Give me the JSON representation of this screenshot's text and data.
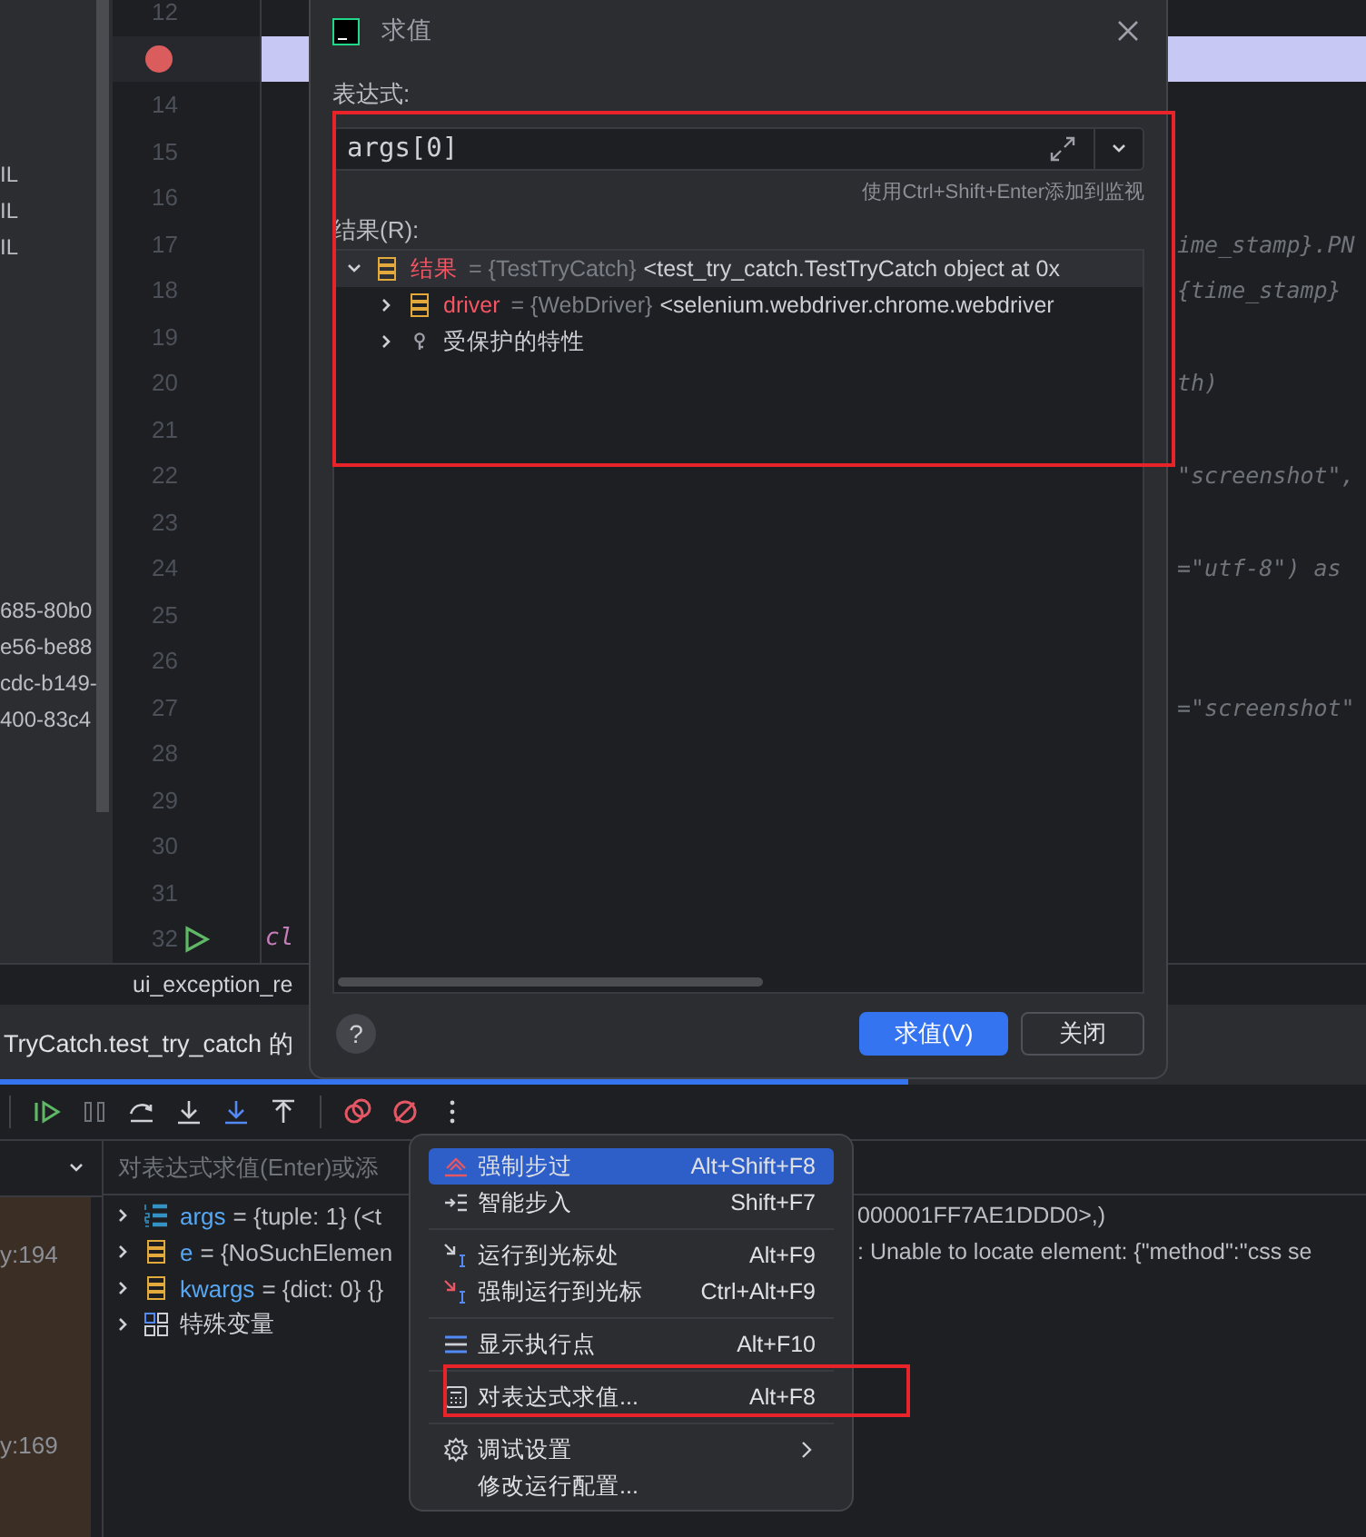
{
  "project_panel": {
    "file_rows": [
      {
        "label": "IL"
      },
      {
        "label": "IL"
      },
      {
        "label": "IL"
      }
    ],
    "id_rows": [
      {
        "label": "685-80b0"
      },
      {
        "label": "e56-be88"
      },
      {
        "label": "cdc-b149-"
      },
      {
        "label": "400-83c4"
      }
    ]
  },
  "editor": {
    "lines": [
      {
        "number": "12",
        "kind": "plain",
        "breakpoint": false,
        "current": false
      },
      {
        "kind": "plain",
        "breakpoint": true,
        "current": true
      },
      {
        "number": "14",
        "kind": "plain",
        "breakpoint": false,
        "current": false
      },
      {
        "number": "15",
        "kind": "plain",
        "breakpoint": false,
        "current": false
      },
      {
        "number": "16",
        "kind": "plain",
        "breakpoint": false,
        "current": false
      },
      {
        "number": "17",
        "kind": "clipped",
        "code": "ime_stamp}.PN",
        "breakpoint": false,
        "current": false
      },
      {
        "number": "18",
        "kind": "clipped",
        "code": "{time_stamp}",
        "breakpoint": false,
        "current": false
      },
      {
        "number": "19",
        "kind": "plain",
        "breakpoint": false,
        "current": false
      },
      {
        "number": "20",
        "kind": "clipped",
        "code": "th)",
        "breakpoint": false,
        "current": false
      },
      {
        "number": "21",
        "kind": "plain",
        "breakpoint": false,
        "current": false
      },
      {
        "number": "22",
        "kind": "clipped",
        "code": "\"screenshot\",",
        "breakpoint": false,
        "current": false
      },
      {
        "number": "23",
        "kind": "plain",
        "breakpoint": false,
        "current": false
      },
      {
        "number": "24",
        "kind": "clipped",
        "code": "=\"utf-8\") as",
        "breakpoint": false,
        "current": false
      },
      {
        "number": "25",
        "kind": "plain",
        "breakpoint": false,
        "current": false
      },
      {
        "number": "26",
        "kind": "plain",
        "breakpoint": false,
        "current": false
      },
      {
        "number": "27",
        "kind": "clipped",
        "code": "=\"screenshot\"",
        "breakpoint": false,
        "current": false
      },
      {
        "number": "28",
        "kind": "plain",
        "breakpoint": false,
        "current": false
      },
      {
        "number": "29",
        "kind": "plain",
        "breakpoint": false,
        "current": false
      },
      {
        "number": "30",
        "kind": "plain",
        "breakpoint": false,
        "current": false
      },
      {
        "number": "31",
        "kind": "plain",
        "breakpoint": false,
        "current": false
      },
      {
        "number": "32",
        "kind": "class",
        "code": "cl",
        "breakpoint": false,
        "current": false
      }
    ]
  },
  "editor_tab": {
    "label": "ui_exception_re"
  },
  "debug_tab": {
    "label": "TryCatch.test_try_catch 的",
    "selected": true
  },
  "frames": [
    {
      "label": "y:194"
    },
    {
      "label": "y:169"
    }
  ],
  "variables": {
    "placeholder": "对表达式求值(Enter)或添",
    "rows": [
      {
        "kind": "list",
        "name": "args",
        "value": "= {tuple: 1} (<t",
        "tail": "000001FF7AE1DDD0>,)"
      },
      {
        "kind": "object",
        "name": "e",
        "value": "= {NoSuchElemen",
        "tail": ": Unable to locate element: {\"method\":\"css se"
      },
      {
        "kind": "object",
        "name": "kwargs",
        "value": "= {dict: 0} {}"
      },
      {
        "kind": "group",
        "name": "特殊变量"
      }
    ]
  },
  "evaluate_dialog": {
    "title": "求值",
    "expression_label": "表达式:",
    "expression": "args[0]",
    "hint": "使用Ctrl+Shift+Enter添加到监视",
    "result_label": "结果(R):",
    "results": [
      {
        "kind": "object",
        "name": "结果",
        "type": "= {TestTryCatch}",
        "value": "<test_try_catch.TestTryCatch object at 0x",
        "expanded": true,
        "selected": true,
        "children": [
          {
            "kind": "object",
            "name": "driver",
            "type": "= {WebDriver}",
            "value": "<selenium.webdriver.chrome.webdriver",
            "expanded": false,
            "selected": false
          },
          {
            "kind": "group",
            "name": "受保护的特性",
            "expanded": false,
            "selected": false
          }
        ]
      }
    ],
    "help": "?",
    "buttons": [
      {
        "label": "求值(V)",
        "kind": "primary"
      },
      {
        "label": "关闭",
        "kind": "secondary"
      }
    ]
  },
  "context_menu": {
    "groups": [
      [
        {
          "label": "强制步过",
          "shortcut": "Alt+Shift+F8",
          "selected": true
        },
        {
          "label": "智能步入",
          "shortcut": "Shift+F7",
          "selected": false
        }
      ],
      [
        {
          "label": "运行到光标处",
          "shortcut": "Alt+F9",
          "selected": false
        },
        {
          "label": "强制运行到光标",
          "shortcut": "Ctrl+Alt+F9",
          "selected": false
        }
      ],
      [
        {
          "label": "显示执行点",
          "shortcut": "Alt+F10",
          "selected": false
        }
      ],
      [
        {
          "label": "对表达式求值...",
          "shortcut": "Alt+F8",
          "selected": false
        }
      ],
      [
        {
          "label": "调试设置",
          "submenu": true,
          "selected": false
        },
        {
          "label": "修改运行配置...",
          "selected": false
        }
      ]
    ]
  }
}
